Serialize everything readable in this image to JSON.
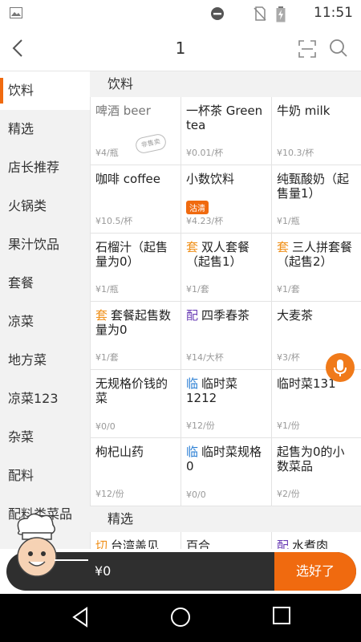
{
  "status_bar": {
    "time": "11:51",
    "icons": [
      "image-icon",
      "do-not-disturb-icon",
      "no-sim-icon",
      "battery-charging-icon"
    ]
  },
  "header": {
    "title": "1",
    "icons": [
      "back-chevron-icon",
      "scan-icon",
      "search-icon"
    ]
  },
  "sidebar": {
    "items": [
      {
        "label": "饮料",
        "active": true
      },
      {
        "label": "精选",
        "active": false
      },
      {
        "label": "店长推荐",
        "active": false
      },
      {
        "label": "火锅类",
        "active": false
      },
      {
        "label": "果汁饮品",
        "active": false
      },
      {
        "label": "套餐",
        "active": false
      },
      {
        "label": "凉菜",
        "active": false
      },
      {
        "label": "地方菜",
        "active": false
      },
      {
        "label": "凉菜123",
        "active": false
      },
      {
        "label": "杂菜",
        "active": false
      },
      {
        "label": "配料",
        "active": false
      },
      {
        "label": "配料类菜品",
        "active": false
      }
    ]
  },
  "content": {
    "section_1": {
      "title": "饮料",
      "products": [
        {
          "tag": "",
          "name": "啤酒 beer",
          "price": "¥4/瓶",
          "stamp": "非售卖"
        },
        {
          "tag": "",
          "name": "一杯茶 Green tea",
          "price": "¥0.01/杯"
        },
        {
          "tag": "",
          "name": "牛奶 milk",
          "price": "¥10.3/杯"
        },
        {
          "tag": "",
          "name": "咖啡 coffee",
          "price": "¥10.5/杯"
        },
        {
          "tag": "",
          "name": "小数饮料",
          "price": "¥4.23/杯",
          "badge": "沽清"
        },
        {
          "tag": "",
          "name": "纯甄酸奶（起售量1）",
          "price": "¥1/瓶"
        },
        {
          "tag": "",
          "name": "石榴汁（起售量为0）",
          "price": "¥1/瓶"
        },
        {
          "tag": "套",
          "name": "双人套餐（起售1）",
          "price": "¥1/套"
        },
        {
          "tag": "套",
          "name": "三人拼套餐（起售2）",
          "price": "¥1/套"
        },
        {
          "tag": "套",
          "name": "套餐起售数量为0",
          "price": "¥1/套"
        },
        {
          "tag": "配",
          "name": "四季春茶",
          "price": "¥14/大杯"
        },
        {
          "tag": "",
          "name": "大麦茶",
          "price": "¥3/杯"
        },
        {
          "tag": "",
          "name": "无规格价钱的菜",
          "price": "¥0/0"
        },
        {
          "tag": "临",
          "name": "临时菜1212",
          "price": "¥12/份"
        },
        {
          "tag": "",
          "name": "临时菜131",
          "price": "¥1/份"
        },
        {
          "tag": "",
          "name": "枸杞山药",
          "price": "¥12/份"
        },
        {
          "tag": "临",
          "name": "临时菜规格0",
          "price": "¥0/0"
        },
        {
          "tag": "",
          "name": "起售为0的小数菜品",
          "price": "¥2/份"
        }
      ]
    },
    "section_2": {
      "title": "精选",
      "products": [
        {
          "tag": "切",
          "name": "台湾盖见",
          "price": ""
        },
        {
          "tag": "",
          "name": "百合",
          "price": ""
        },
        {
          "tag": "配",
          "name": "水煮肉",
          "price": ""
        }
      ]
    }
  },
  "cart": {
    "total": "¥0",
    "checkout_label": "选好了"
  },
  "colors": {
    "accent": "#f06a0f",
    "tag_orange": "#f0901a",
    "tag_blue": "#2a7fd4",
    "tag_purple": "#6a3db5",
    "cart_bg": "#2f2f2f"
  }
}
